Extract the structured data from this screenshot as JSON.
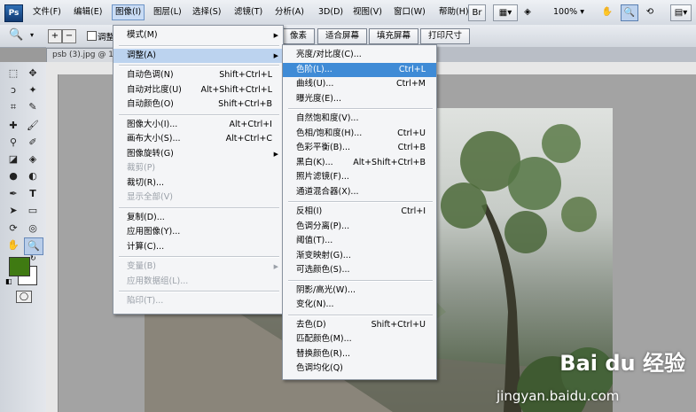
{
  "app": {
    "logo": "Ps"
  },
  "menubar": {
    "items": [
      "文件(F)",
      "编辑(E)",
      "图像(I)",
      "图层(L)",
      "选择(S)",
      "滤镜(T)",
      "分析(A)",
      "3D(D)",
      "视图(V)",
      "窗口(W)",
      "帮助(H)"
    ],
    "zoom": "100%",
    "icons": [
      "bridge-icon",
      "layout-icon",
      "hand-icon",
      "zoom-icon",
      "rotate-icon",
      "workspace-icon"
    ]
  },
  "options_bar": {
    "checkbox_label": "调整",
    "buttons": [
      "像素",
      "适合屏幕",
      "填充屏幕",
      "打印尺寸"
    ]
  },
  "document": {
    "tab_title": "psb (3).jpg @ 10"
  },
  "image_menu": {
    "items": [
      {
        "label": "模式(M)",
        "shortcut": "",
        "submenu": true
      },
      {
        "sep": true
      },
      {
        "label": "调整(A)",
        "shortcut": "",
        "submenu": true,
        "active": true
      },
      {
        "sep": true
      },
      {
        "label": "自动色调(N)",
        "shortcut": "Shift+Ctrl+L"
      },
      {
        "label": "自动对比度(U)",
        "shortcut": "Alt+Shift+Ctrl+L"
      },
      {
        "label": "自动颜色(O)",
        "shortcut": "Shift+Ctrl+B"
      },
      {
        "sep": true
      },
      {
        "label": "图像大小(I)...",
        "shortcut": "Alt+Ctrl+I"
      },
      {
        "label": "画布大小(S)...",
        "shortcut": "Alt+Ctrl+C"
      },
      {
        "label": "图像旋转(G)",
        "shortcut": "",
        "submenu": true
      },
      {
        "label": "裁剪(P)",
        "shortcut": "",
        "disabled": true
      },
      {
        "label": "裁切(R)...",
        "shortcut": ""
      },
      {
        "label": "显示全部(V)",
        "shortcut": "",
        "disabled": true
      },
      {
        "sep": true
      },
      {
        "label": "复制(D)...",
        "shortcut": ""
      },
      {
        "label": "应用图像(Y)...",
        "shortcut": ""
      },
      {
        "label": "计算(C)...",
        "shortcut": ""
      },
      {
        "sep": true
      },
      {
        "label": "变量(B)",
        "shortcut": "",
        "submenu": true,
        "disabled": true
      },
      {
        "label": "应用数据组(L)...",
        "shortcut": "",
        "disabled": true
      },
      {
        "sep": true
      },
      {
        "label": "陷印(T)...",
        "shortcut": "",
        "disabled": true
      }
    ]
  },
  "adjust_menu": {
    "items": [
      {
        "label": "亮度/对比度(C)...",
        "shortcut": ""
      },
      {
        "label": "色阶(L)...",
        "shortcut": "Ctrl+L",
        "highlighted": true
      },
      {
        "label": "曲线(U)...",
        "shortcut": "Ctrl+M"
      },
      {
        "label": "曝光度(E)...",
        "shortcut": ""
      },
      {
        "sep": true
      },
      {
        "label": "自然饱和度(V)...",
        "shortcut": ""
      },
      {
        "label": "色相/饱和度(H)...",
        "shortcut": "Ctrl+U"
      },
      {
        "label": "色彩平衡(B)...",
        "shortcut": "Ctrl+B"
      },
      {
        "label": "黑白(K)...",
        "shortcut": "Alt+Shift+Ctrl+B"
      },
      {
        "label": "照片滤镜(F)...",
        "shortcut": ""
      },
      {
        "label": "通道混合器(X)...",
        "shortcut": ""
      },
      {
        "sep": true
      },
      {
        "label": "反相(I)",
        "shortcut": "Ctrl+I"
      },
      {
        "label": "色调分离(P)...",
        "shortcut": ""
      },
      {
        "label": "阈值(T)...",
        "shortcut": ""
      },
      {
        "label": "渐变映射(G)...",
        "shortcut": ""
      },
      {
        "label": "可选颜色(S)...",
        "shortcut": ""
      },
      {
        "sep": true
      },
      {
        "label": "阴影/高光(W)...",
        "shortcut": ""
      },
      {
        "label": "变化(N)...",
        "shortcut": ""
      },
      {
        "sep": true
      },
      {
        "label": "去色(D)",
        "shortcut": "Shift+Ctrl+U"
      },
      {
        "label": "匹配颜色(M)...",
        "shortcut": ""
      },
      {
        "label": "替换颜色(R)...",
        "shortcut": ""
      },
      {
        "label": "色调均化(Q)",
        "shortcut": ""
      }
    ]
  },
  "colors": {
    "foreground": "#3f7a12",
    "background": "#ffffff",
    "highlight": "#3f8bd6"
  },
  "watermark": {
    "brand": "Bai du 经验",
    "url": "jingyan.baidu.com"
  }
}
